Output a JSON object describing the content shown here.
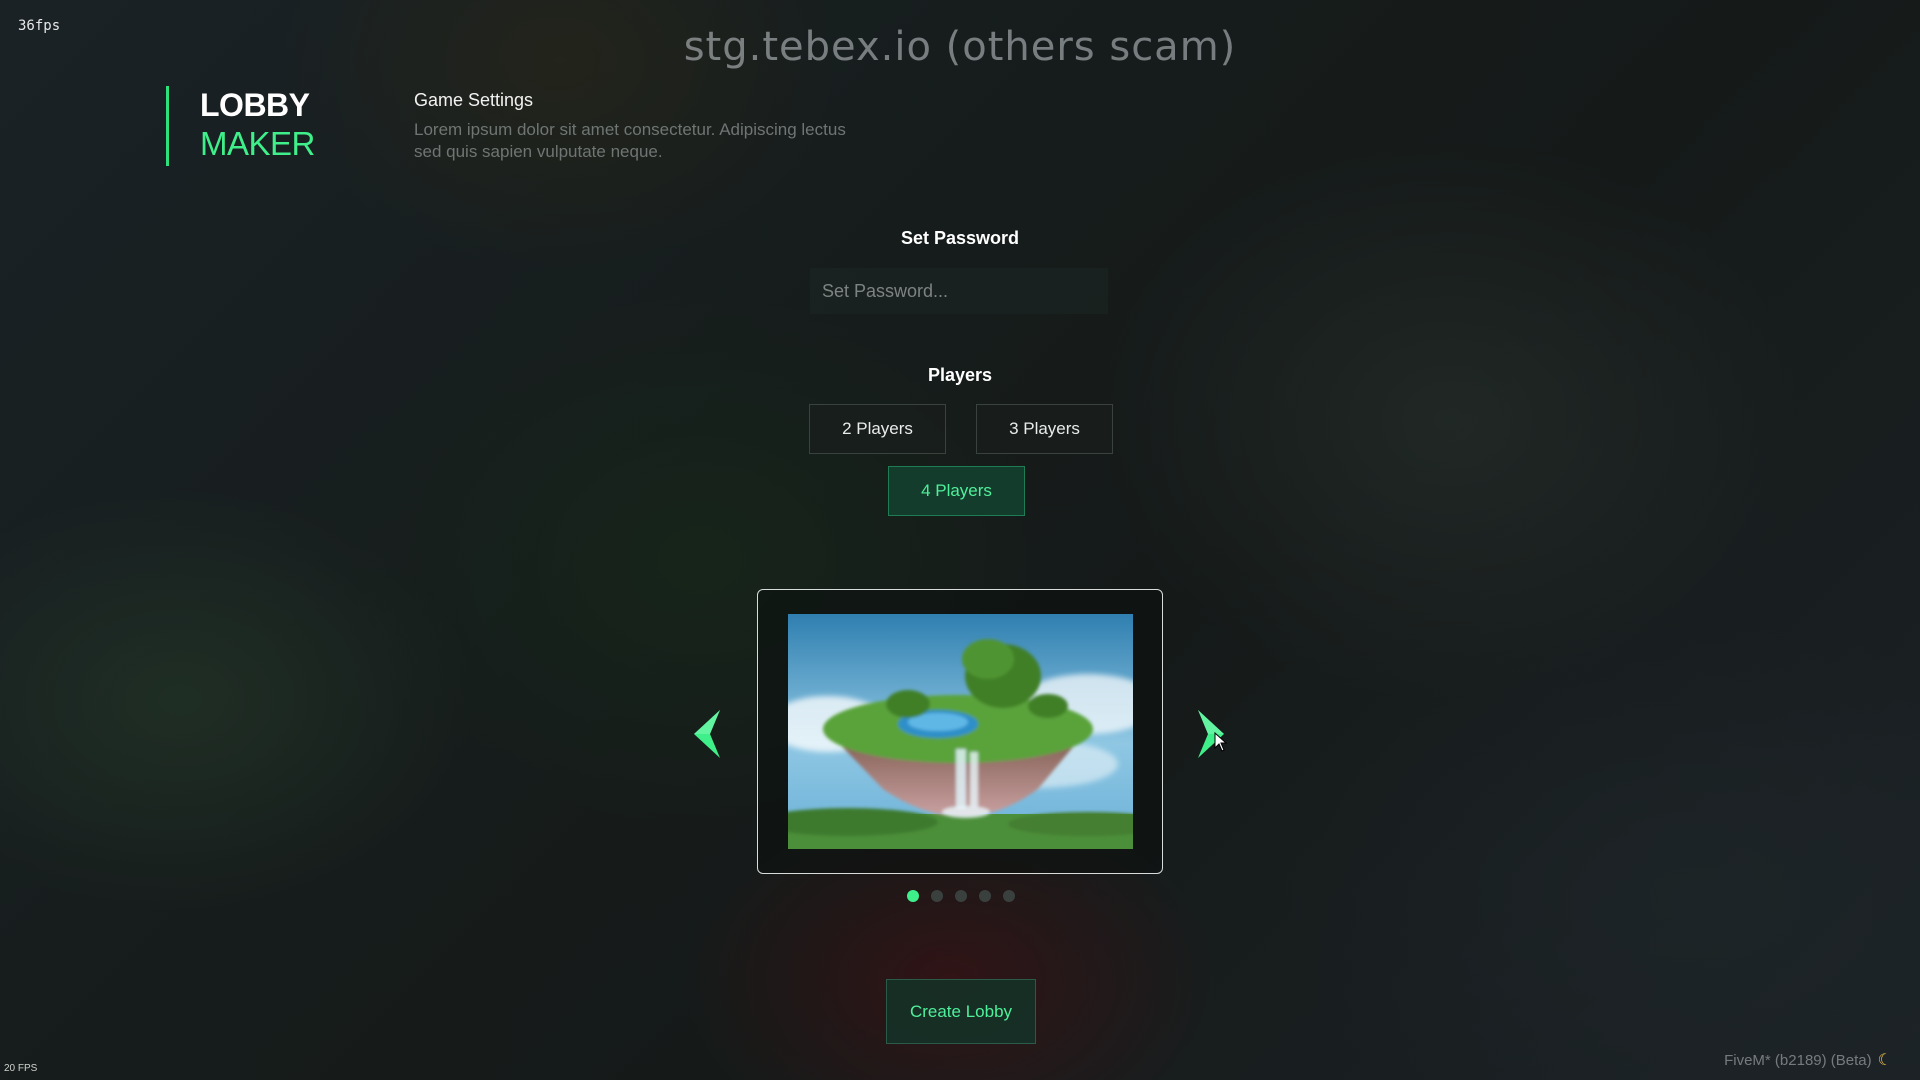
{
  "overlay": {
    "fps_top": "36fps",
    "fps_bottom": "20 FPS",
    "watermark": "stg.tebex.io (others scam)",
    "version": "FiveM* (b2189) (Beta)",
    "version_icon": "moon-icon"
  },
  "brand": {
    "line1": "LOBBY",
    "line2": "MAKER",
    "accent_color": "#3ff08a"
  },
  "settings": {
    "title": "Game Settings",
    "description": "Lorem ipsum dolor sit amet consectetur. Adipiscing lectus sed quis sapien vulputate neque."
  },
  "password": {
    "label": "Set Password",
    "placeholder": "Set Password...",
    "value": ""
  },
  "players": {
    "label": "Players",
    "options": [
      {
        "label": "2 Players",
        "selected": false
      },
      {
        "label": "3 Players",
        "selected": false
      },
      {
        "label": "4 Players",
        "selected": true
      }
    ]
  },
  "carousel": {
    "prev_icon": "chevron-left-icon",
    "next_icon": "chevron-right-icon",
    "slide_count": 5,
    "active_index": 0
  },
  "actions": {
    "create_label": "Create Lobby"
  }
}
